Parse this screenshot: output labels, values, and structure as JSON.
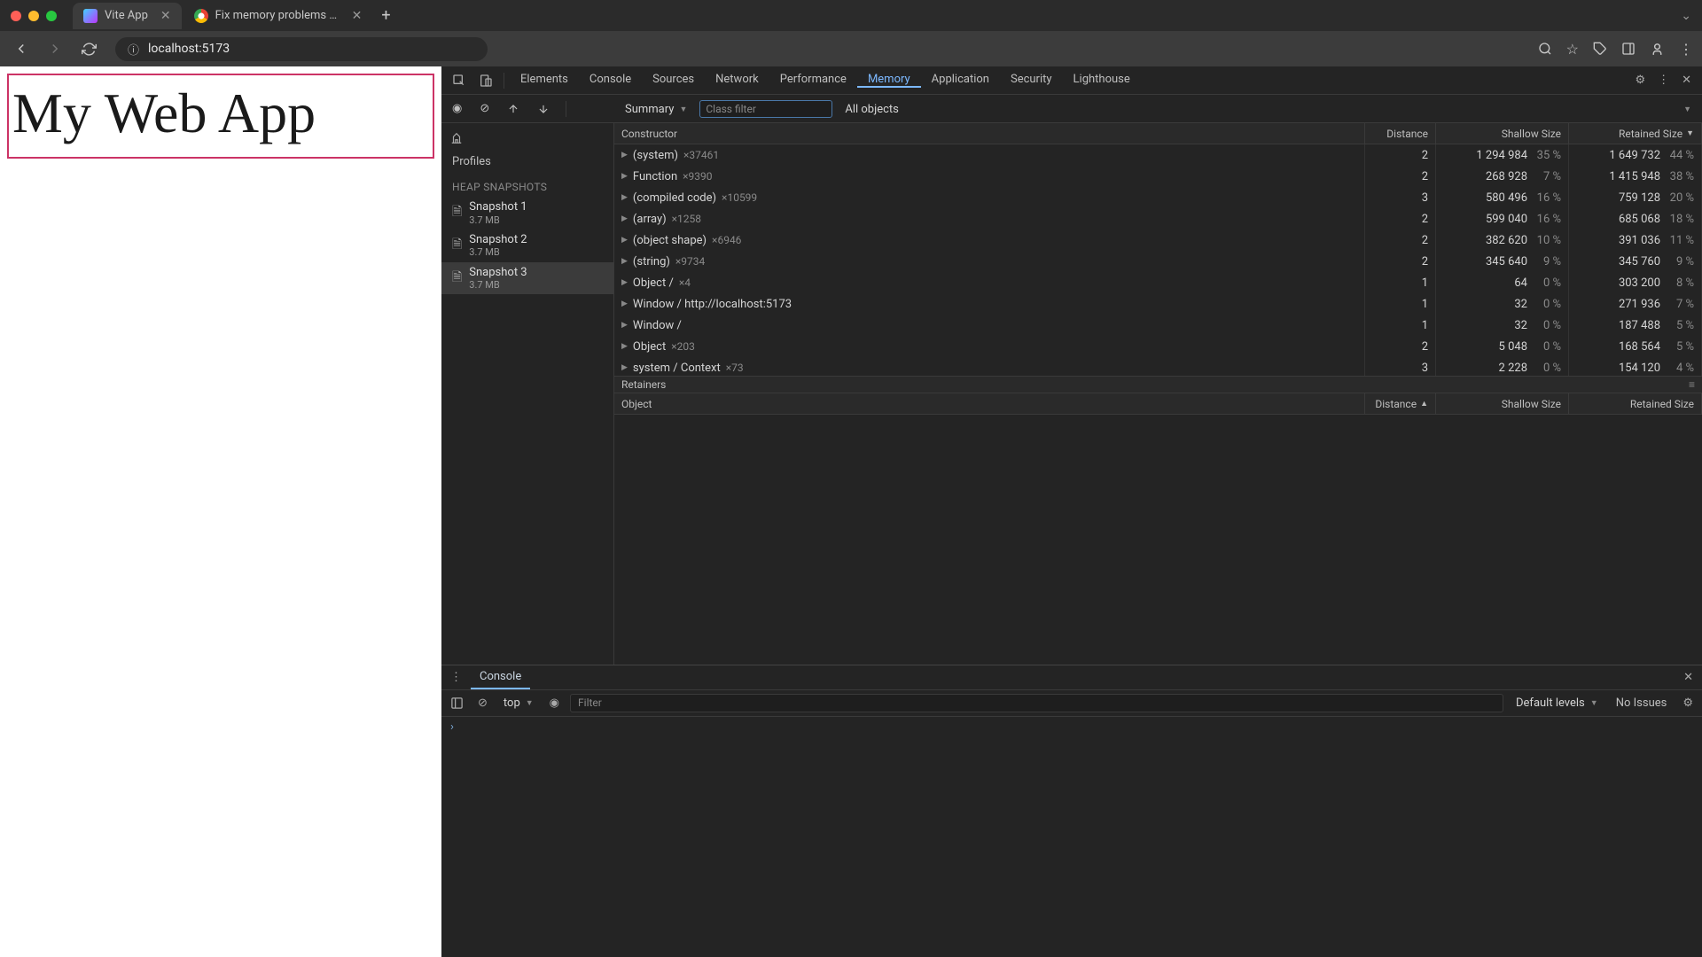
{
  "browser": {
    "tabs": [
      {
        "title": "Vite App",
        "favicon_color": "#8b5cf6"
      },
      {
        "title": "Fix memory problems  |  Dev",
        "favicon_color": "#34a853"
      }
    ],
    "url": "localhost:5173"
  },
  "page": {
    "title": "My Web App"
  },
  "devtools": {
    "tabs": [
      "Elements",
      "Console",
      "Sources",
      "Network",
      "Performance",
      "Memory",
      "Application",
      "Security",
      "Lighthouse"
    ],
    "active_tab": "Memory",
    "toolbar": {
      "view_mode": "Summary",
      "class_filter_placeholder": "Class filter",
      "object_filter": "All objects"
    },
    "sidebar": {
      "profiles_label": "Profiles",
      "heap_label": "HEAP SNAPSHOTS",
      "snapshots": [
        {
          "name": "Snapshot 1",
          "size": "3.7 MB"
        },
        {
          "name": "Snapshot 2",
          "size": "3.7 MB"
        },
        {
          "name": "Snapshot 3",
          "size": "3.7 MB"
        }
      ],
      "selected": 2
    },
    "grid": {
      "cols": [
        "Constructor",
        "Distance",
        "Shallow Size",
        "Retained Size"
      ],
      "rows": [
        {
          "name": "(system)",
          "mult": "×37461",
          "dist": "2",
          "shallow": "1 294 984",
          "shallow_pct": "35 %",
          "retained": "1 649 732",
          "retained_pct": "44 %"
        },
        {
          "name": "Function",
          "mult": "×9390",
          "dist": "2",
          "shallow": "268 928",
          "shallow_pct": "7 %",
          "retained": "1 415 948",
          "retained_pct": "38 %"
        },
        {
          "name": "(compiled code)",
          "mult": "×10599",
          "dist": "3",
          "shallow": "580 496",
          "shallow_pct": "16 %",
          "retained": "759 128",
          "retained_pct": "20 %"
        },
        {
          "name": "(array)",
          "mult": "×1258",
          "dist": "2",
          "shallow": "599 040",
          "shallow_pct": "16 %",
          "retained": "685 068",
          "retained_pct": "18 %"
        },
        {
          "name": "(object shape)",
          "mult": "×6946",
          "dist": "2",
          "shallow": "382 620",
          "shallow_pct": "10 %",
          "retained": "391 036",
          "retained_pct": "11 %"
        },
        {
          "name": "(string)",
          "mult": "×9734",
          "dist": "2",
          "shallow": "345 640",
          "shallow_pct": "9 %",
          "retained": "345 760",
          "retained_pct": "9 %"
        },
        {
          "name": "Object /",
          "mult": "×4",
          "dist": "1",
          "shallow": "64",
          "shallow_pct": "0 %",
          "retained": "303 200",
          "retained_pct": "8 %"
        },
        {
          "name": "Window / http://localhost:5173",
          "mult": "",
          "dist": "1",
          "shallow": "32",
          "shallow_pct": "0 %",
          "retained": "271 936",
          "retained_pct": "7 %"
        },
        {
          "name": "Window /",
          "mult": "",
          "dist": "1",
          "shallow": "32",
          "shallow_pct": "0 %",
          "retained": "187 488",
          "retained_pct": "5 %"
        },
        {
          "name": "Object",
          "mult": "×203",
          "dist": "2",
          "shallow": "5 048",
          "shallow_pct": "0 %",
          "retained": "168 564",
          "retained_pct": "5 %"
        },
        {
          "name": "system / Context",
          "mult": "×73",
          "dist": "3",
          "shallow": "2 228",
          "shallow_pct": "0 %",
          "retained": "154 120",
          "retained_pct": "4 %"
        }
      ]
    },
    "retainers": {
      "title": "Retainers",
      "cols": [
        "Object",
        "Distance",
        "Shallow Size",
        "Retained Size"
      ],
      "sort_asc_on": 1
    }
  },
  "console": {
    "tab_label": "Console",
    "context": "top",
    "filter_placeholder": "Filter",
    "levels": "Default levels",
    "issues": "No Issues"
  }
}
